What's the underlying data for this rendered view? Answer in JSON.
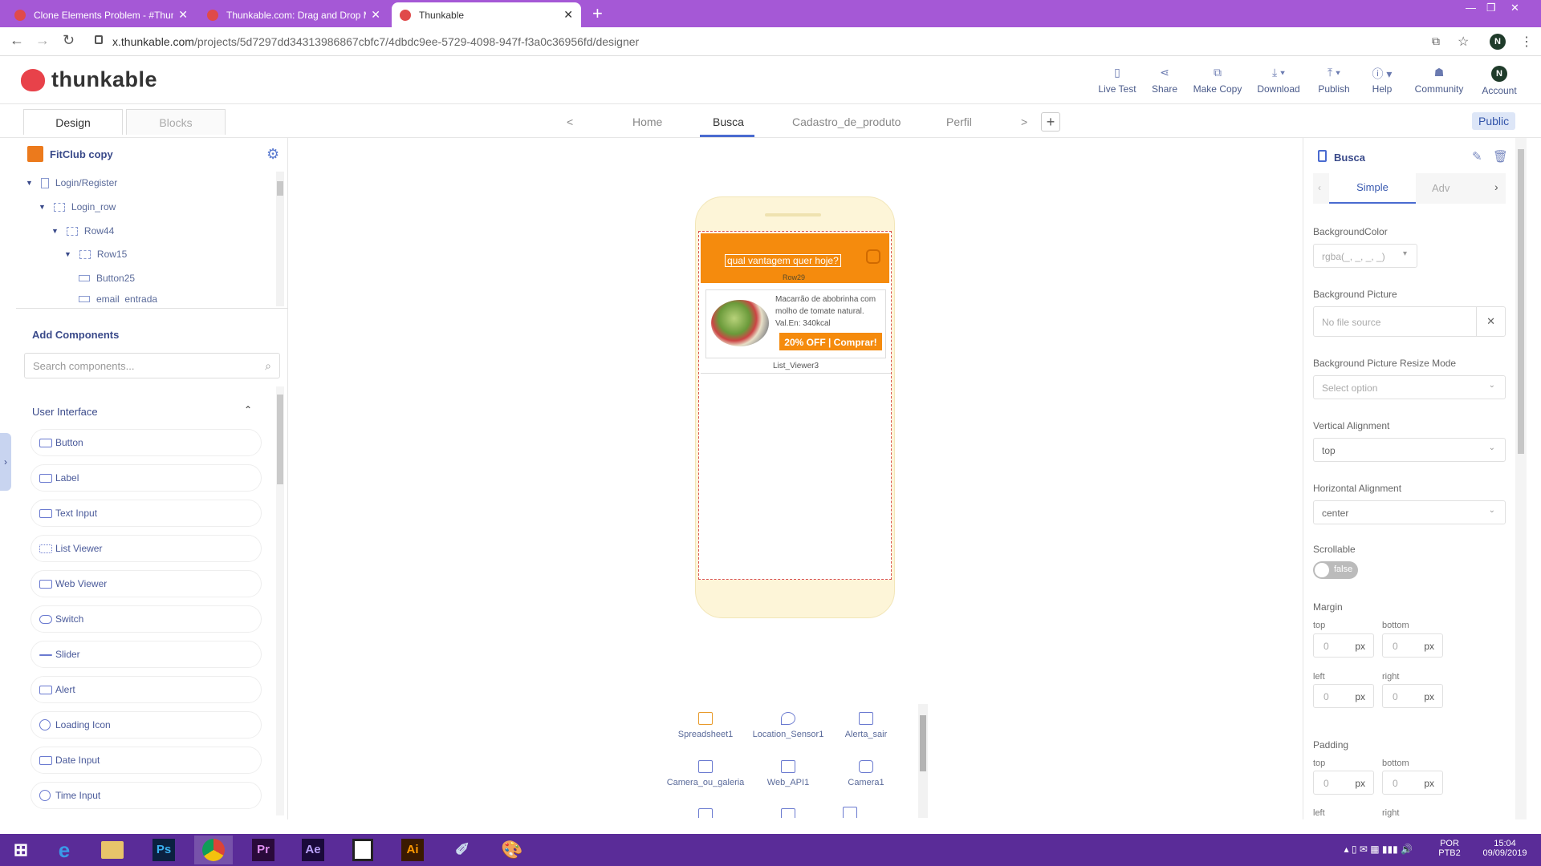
{
  "browser": {
    "tabs": [
      {
        "title": "Clone Elements Problem - #Thunkable",
        "active": false
      },
      {
        "title": "Thunkable.com: Drag and Drop Mobile App",
        "active": false
      },
      {
        "title": "Thunkable",
        "active": true
      }
    ],
    "url_host": "x.thunkable.com",
    "url_path": "/projects/5d7297dd34313986867cbfc7/4dbdc9ee-5729-4098-947f-f3a0c36956fd/designer",
    "user_initial": "N"
  },
  "app_header": {
    "logo_text": "thunkable",
    "items": [
      {
        "label": "Live Test",
        "icon": "phone-icon"
      },
      {
        "label": "Share",
        "icon": "share-icon"
      },
      {
        "label": "Make Copy",
        "icon": "copy-icon"
      },
      {
        "label": "Download",
        "icon": "download-icon"
      },
      {
        "label": "Publish",
        "icon": "publish-icon"
      },
      {
        "label": "Help",
        "icon": "help-icon"
      },
      {
        "label": "Community",
        "icon": "community-icon"
      },
      {
        "label": "Account",
        "icon": "avatar"
      }
    ],
    "account_initial": "N"
  },
  "designer": {
    "design_tab": "Design",
    "blocks_tab": "Blocks",
    "screens": [
      "Home",
      "Busca",
      "Cadastro_de_produto",
      "Perfil"
    ],
    "active_screen": "Busca",
    "public_label": "Public"
  },
  "left_panel": {
    "project_name": "FitClub copy",
    "tree": [
      {
        "label": "Login/Register",
        "depth": 0,
        "expanded": true
      },
      {
        "label": "Login_row",
        "depth": 1,
        "expanded": true
      },
      {
        "label": "Row44",
        "depth": 2,
        "expanded": true
      },
      {
        "label": "Row15",
        "depth": 3,
        "expanded": true
      },
      {
        "label": "Button25",
        "depth": 4,
        "expanded": false
      },
      {
        "label": "email_entrada",
        "depth": 4,
        "expanded": false
      }
    ],
    "add_components_title": "Add Components",
    "search_placeholder": "Search components...",
    "category": "User Interface",
    "components": [
      "Button",
      "Label",
      "Text Input",
      "List Viewer",
      "Web Viewer",
      "Switch",
      "Slider",
      "Alert",
      "Loading Icon",
      "Date Input",
      "Time Input"
    ]
  },
  "canvas": {
    "search_text": "qual vantagem quer hoje?",
    "row_label": "Row29",
    "item_description": "Macarrão de abobrinha com molho de tomate natural. Val.En: 340kcal",
    "buy_button": "20% OFF | Comprar!",
    "list_viewer_label": "List_Viewer3",
    "accent_color": "#f58b0d"
  },
  "nonvisible": [
    {
      "label": "Spreadsheet1",
      "icon": "spreadsheet-icon"
    },
    {
      "label": "Location_Sensor1",
      "icon": "location-icon"
    },
    {
      "label": "Alerta_sair",
      "icon": "alert-icon"
    },
    {
      "label": "Camera_ou_galeria",
      "icon": "alert-icon"
    },
    {
      "label": "Web_API1",
      "icon": "api-icon"
    },
    {
      "label": "Camera1",
      "icon": "camera-icon"
    }
  ],
  "right_panel": {
    "title": "Busca",
    "tab_simple": "Simple",
    "tab_advanced": "Adv",
    "background_color_label": "BackgroundColor",
    "background_color_value": "rgba(_, _, _, _)",
    "background_picture_label": "Background Picture",
    "background_picture_value": "No file source",
    "resize_mode_label": "Background Picture Resize Mode",
    "resize_mode_value": "Select option",
    "vertical_alignment_label": "Vertical Alignment",
    "vertical_alignment_value": "top",
    "horizontal_alignment_label": "Horizontal Alignment",
    "horizontal_alignment_value": "center",
    "scrollable_label": "Scrollable",
    "scrollable_value": "false",
    "margin_label": "Margin",
    "padding_label": "Padding",
    "top_label": "top",
    "bottom_label": "bottom",
    "left_label": "left",
    "right_label": "right",
    "zero": "0",
    "unit": "px"
  },
  "taskbar": {
    "apps": [
      "IE",
      "Explorer",
      "Ps",
      "Chrome",
      "Pr",
      "Ae",
      "Notepad",
      "Ai",
      "Pen",
      "Paint"
    ],
    "lang": "POR",
    "layout": "PTB2",
    "time": "15:04",
    "date": "09/09/2019"
  }
}
